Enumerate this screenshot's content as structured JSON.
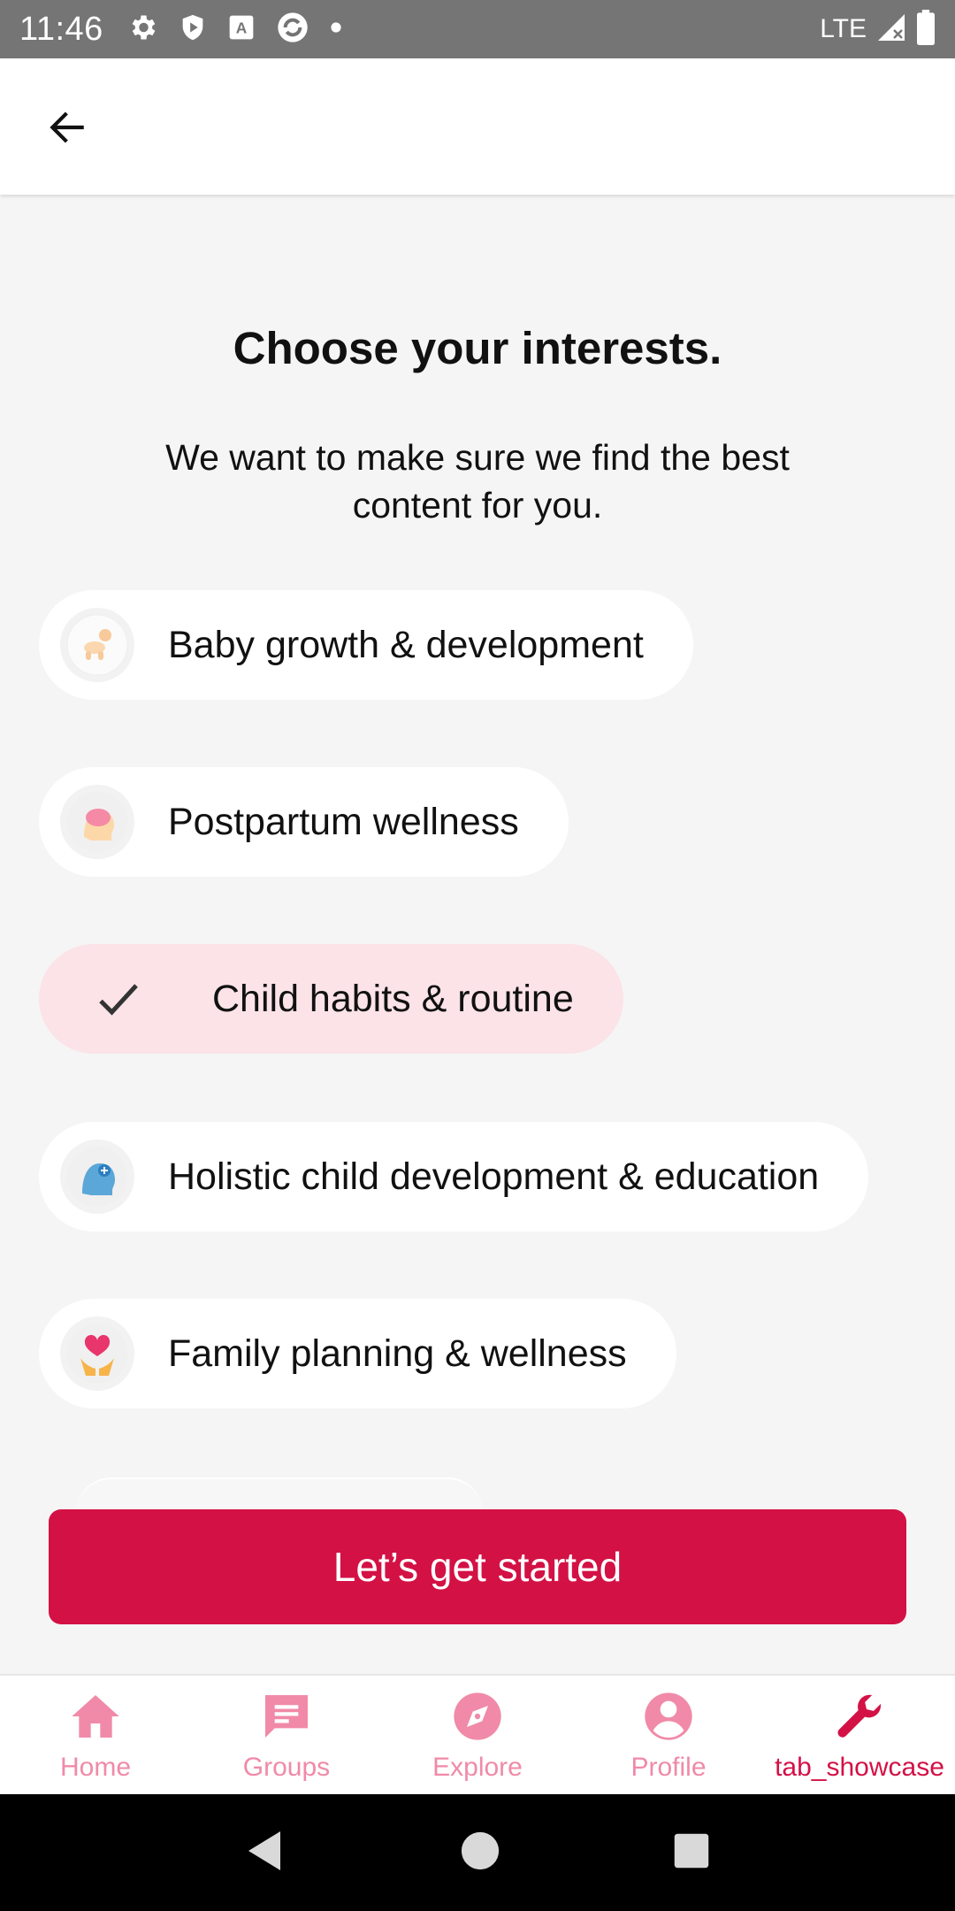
{
  "status_bar": {
    "time": "11:46",
    "network": "LTE",
    "icons": [
      "gear-icon",
      "shield-icon",
      "a-box-icon",
      "sync-icon",
      "dot-icon",
      "signal-icon",
      "battery-icon"
    ]
  },
  "app_bar": {
    "back_icon": "arrow-left-icon"
  },
  "main": {
    "title": "Choose your interests.",
    "subtitle": "We want to make sure we find the best content for you.",
    "interests": [
      {
        "label": "Baby growth & development",
        "icon": "crawling-baby-icon",
        "selected": false
      },
      {
        "label": "Postpartum wellness",
        "icon": "brain-head-icon",
        "selected": false
      },
      {
        "label": "Child habits & routine",
        "icon": "check-icon",
        "selected": true
      },
      {
        "label": "Holistic child development & education",
        "icon": "head-plus-icon",
        "selected": false
      },
      {
        "label": "Family planning & wellness",
        "icon": "heart-hands-icon",
        "selected": false
      }
    ],
    "cta_label": "Let’s get started"
  },
  "bottom_nav": {
    "items": [
      {
        "label": "Home",
        "icon": "home-icon",
        "active": false
      },
      {
        "label": "Groups",
        "icon": "chat-bubble-icon",
        "active": false
      },
      {
        "label": "Explore",
        "icon": "compass-icon",
        "active": false
      },
      {
        "label": "Profile",
        "icon": "person-circle-icon",
        "active": false
      },
      {
        "label": "tab_showcase",
        "icon": "wrench-icon",
        "active": true
      }
    ]
  },
  "colors": {
    "accent": "#d31145",
    "nav_inactive": "#f08aa8",
    "selected_chip": "#fbe3e8",
    "status_bar": "#757575"
  }
}
